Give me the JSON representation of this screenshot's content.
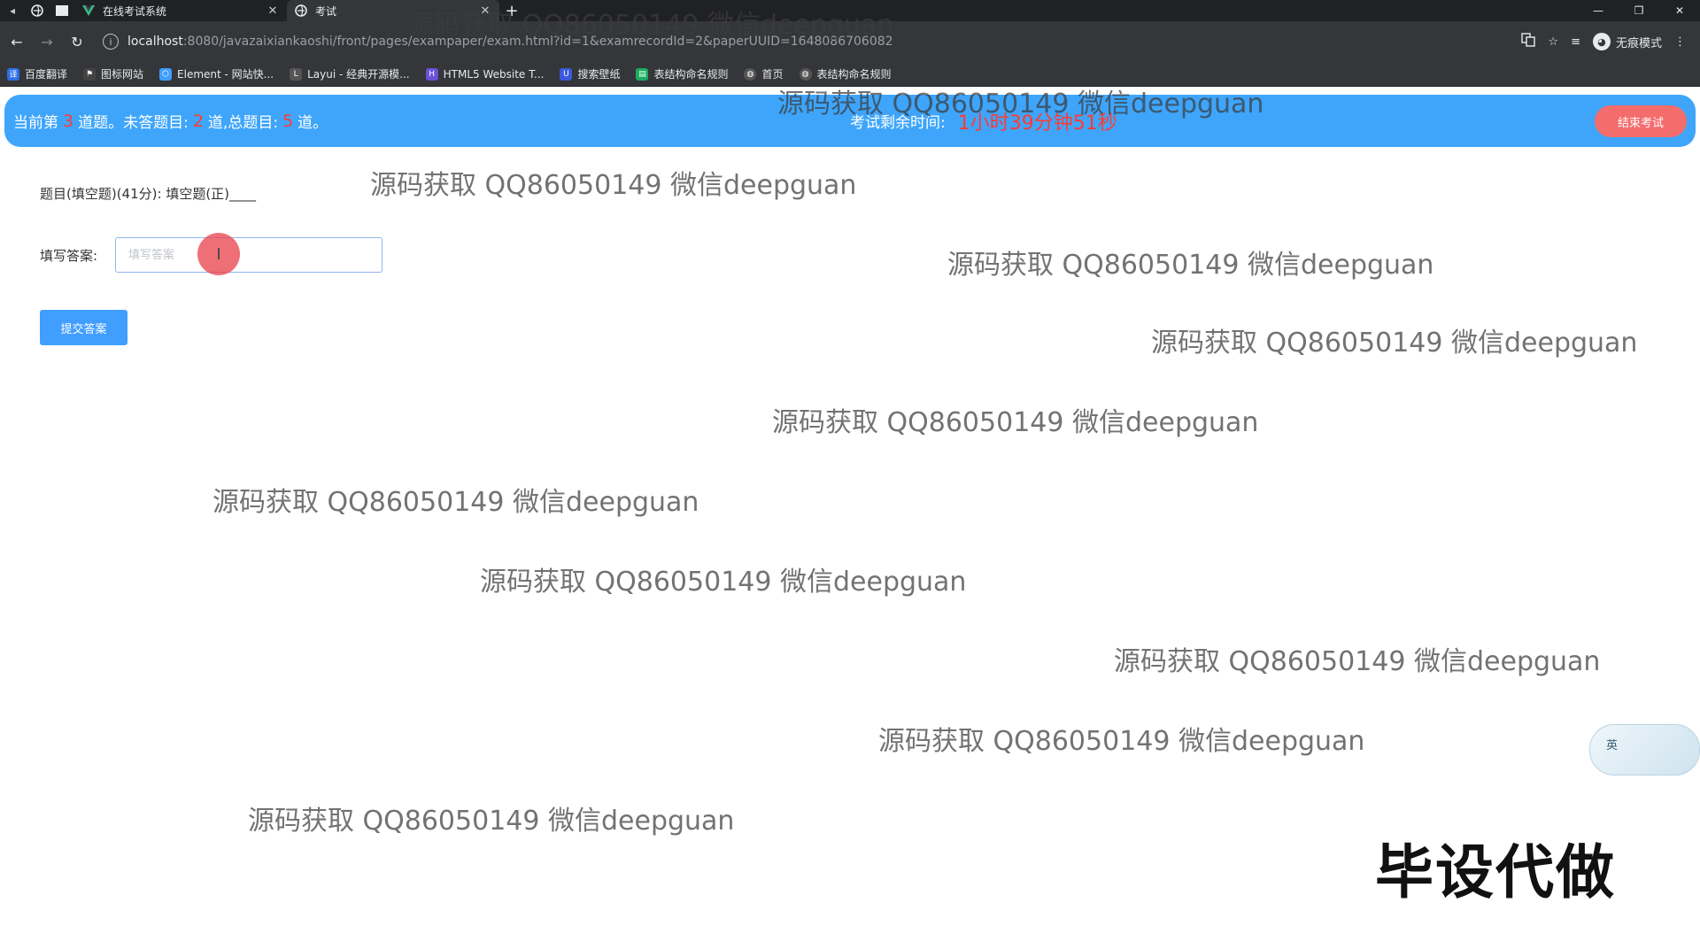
{
  "browser": {
    "tabs": [
      {
        "label": "在线考试系统",
        "active": false
      },
      {
        "label": "考试",
        "active": true
      }
    ],
    "address": {
      "host": "localhost",
      "path": ":8080/javazaixiankaoshi/front/pages/exampaper/exam.html?id=1&examrecordId=2&paperUUID=1648086706082"
    },
    "incognito_label": "无痕模式",
    "bookmarks": [
      {
        "label": "百度翻译",
        "color": "#2f6ee5"
      },
      {
        "label": "图标网站",
        "color": "#444444"
      },
      {
        "label": "Element - 网站快...",
        "color": "#409eff"
      },
      {
        "label": "Layui - 经典开源模...",
        "color": "#555555"
      },
      {
        "label": "HTML5 Website T...",
        "color": "#6b4fd8"
      },
      {
        "label": "搜索壁纸",
        "color": "#3b5bdb"
      },
      {
        "label": "表结构命名规则",
        "color": "#1aad5d"
      },
      {
        "label": "首页",
        "color": "#555555"
      },
      {
        "label": "表结构命名规则",
        "color": "#555555"
      }
    ]
  },
  "exam_bar": {
    "prefix": "当前第",
    "current": "3",
    "mid1": "道题。未答题目:",
    "unanswered": "2",
    "mid2": "道,总题目:",
    "total": "5",
    "suffix": "道。",
    "timer_label": "考试剩余时间:",
    "timer_value": "1小时39分钟51秒",
    "end_button": "结束考试"
  },
  "question": {
    "title": "题目(填空题)(41分): 填空题(正)____",
    "answer_label": "填写答案:",
    "answer_placeholder": "填写答案",
    "submit_label": "提交答案"
  },
  "watermark": "源码获取 QQ86050149 微信deepguan",
  "stamp": "毕设代做",
  "ime_label": "英",
  "colors": {
    "bar_blue": "#3ea5fb",
    "count_red": "#ff3b30",
    "end_button": "#f56c6c",
    "submit_button": "#409eff"
  }
}
